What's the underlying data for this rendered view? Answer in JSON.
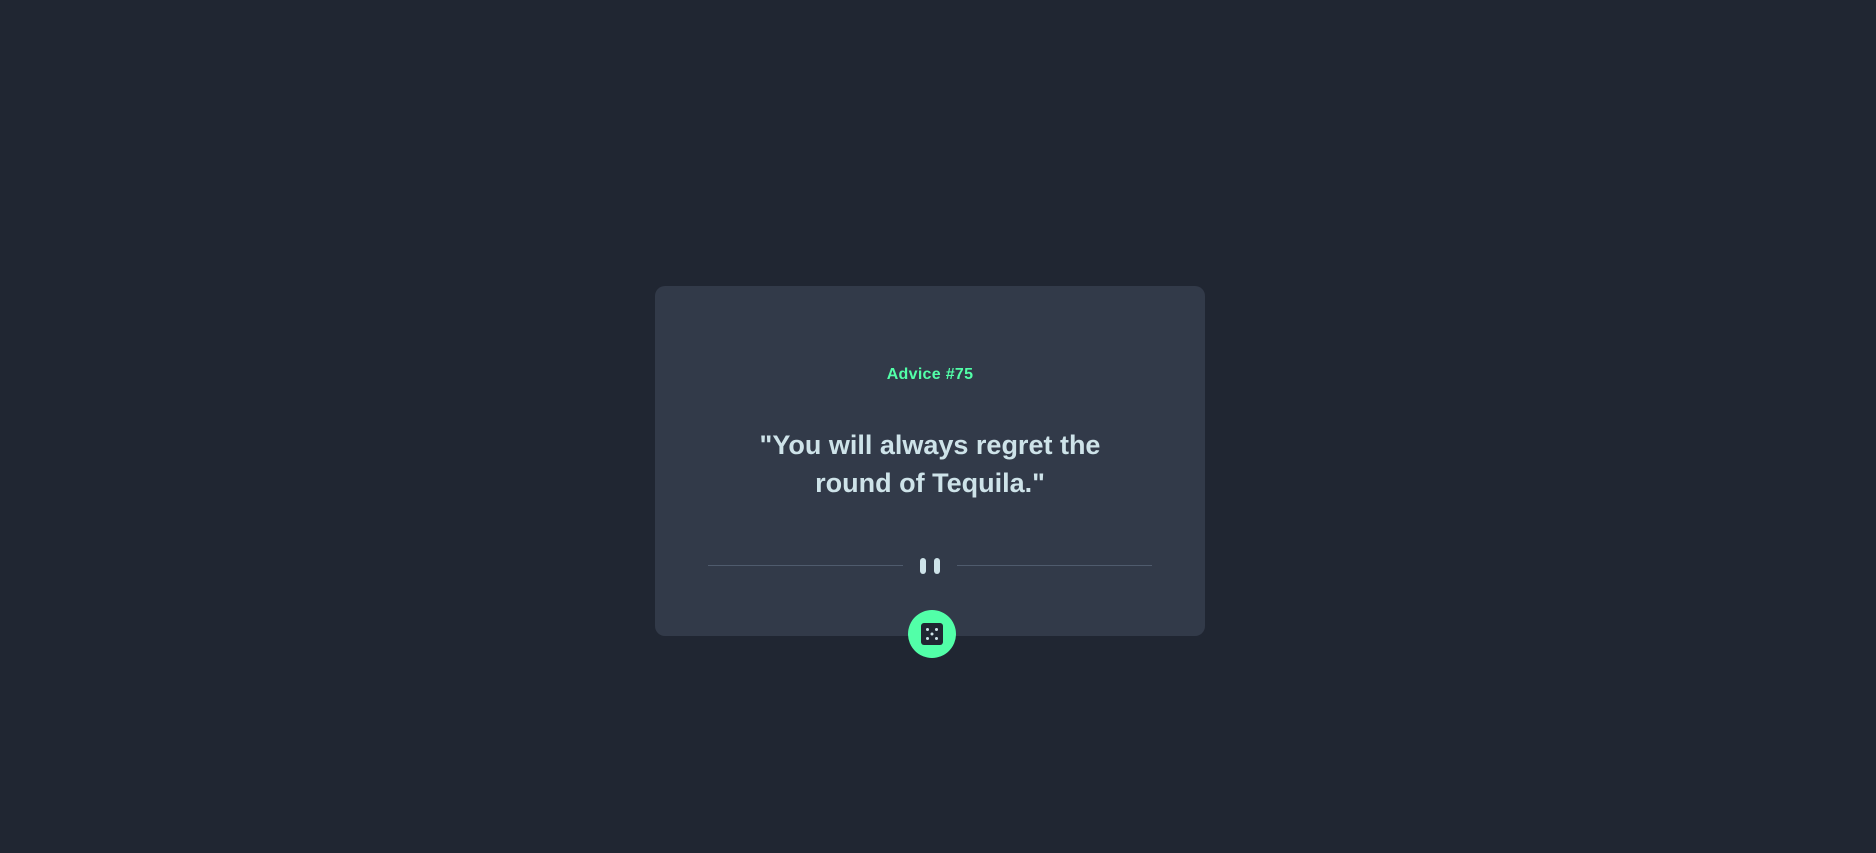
{
  "advice": {
    "label": "Advice #75",
    "quote": "\"You will always regret the round of Tequila.\""
  },
  "colors": {
    "background": "#202632",
    "card": "#323a49",
    "accent": "#52ffa8",
    "text": "#cee3e9",
    "divider": "#4f5b6d"
  },
  "icons": {
    "divider": "pause-icon",
    "button": "dice-icon"
  }
}
